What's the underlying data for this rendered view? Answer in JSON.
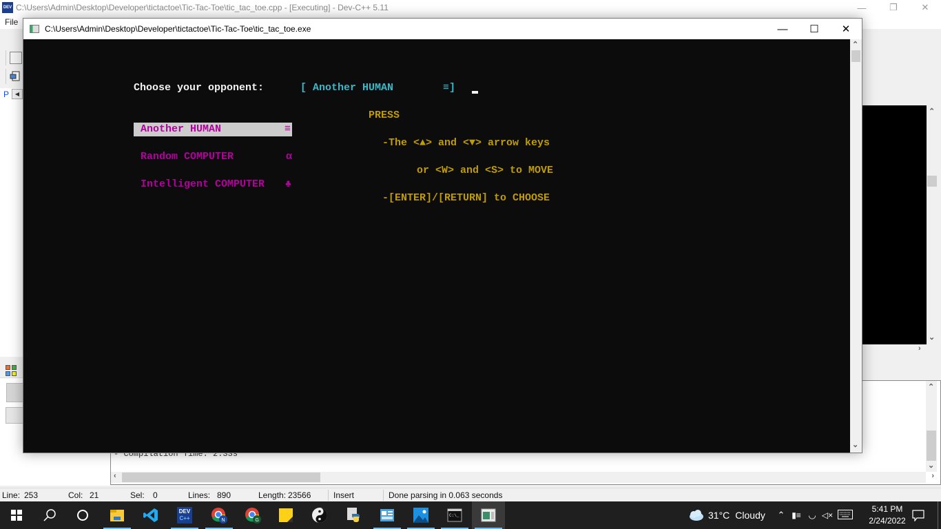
{
  "ide": {
    "title": "C:\\Users\\Admin\\Desktop\\Developer\\tictactoe\\Tic-Tac-Toe\\tic_tac_toe.cpp - [Executing] - Dev-C++ 5.11",
    "logo_text": "DEV",
    "menu_first": "File",
    "left_tab_label": "P",
    "compile_log_text": "- Compilation Time: 2.33s",
    "status": {
      "line_label": "Line:",
      "line_value": "253",
      "col_label": "Col:",
      "col_value": "21",
      "sel_label": "Sel:",
      "sel_value": "0",
      "lines_label": "Lines:",
      "lines_value": "890",
      "length_label": "Length:",
      "length_value": "23566",
      "mode": "Insert",
      "message": "Done parsing in 0.063 seconds"
    }
  },
  "console": {
    "title": "C:\\Users\\Admin\\Desktop\\Developer\\tictactoe\\Tic-Tac-Toe\\tic_tac_toe.exe",
    "prompt_label": "Choose your opponent:",
    "selected_display": "[ Another HUMAN        ≡]",
    "options": [
      {
        "label": "Another HUMAN",
        "symbol": "≡",
        "selected": true
      },
      {
        "label": "Random COMPUTER",
        "symbol": "α",
        "selected": false
      },
      {
        "label": "Intelligent COMPUTER",
        "symbol": "♣",
        "selected": false
      }
    ],
    "help": {
      "heading": "PRESS",
      "line1": "-The <▲> and <▼> arrow keys",
      "line2": "or <W> and <S> to MOVE",
      "line3": "-[ENTER]/[RETURN] to CHOOSE"
    },
    "colors": {
      "background": "#0c0c0c",
      "prompt": "#f2f2f2",
      "selection_display": "#3ab8c8",
      "options": "#b4009e",
      "highlight_bg": "#cccccc",
      "help": "#c19c00"
    }
  },
  "taskbar": {
    "apps": [
      {
        "name": "File Explorer",
        "icon": "folder-icon"
      },
      {
        "name": "Visual Studio Code",
        "icon": "vscode-icon"
      },
      {
        "name": "Dev-C++",
        "icon": "devcpp-icon"
      },
      {
        "name": "Chrome (N)",
        "icon": "chrome-icon"
      },
      {
        "name": "Chrome (G)",
        "icon": "chrome-icon"
      },
      {
        "name": "Sticky Notes",
        "icon": "sticky-notes-icon"
      },
      {
        "name": "Yin Yang App",
        "icon": "yin-yang-icon"
      },
      {
        "name": "Python",
        "icon": "python-icon"
      },
      {
        "name": "Control Panel",
        "icon": "control-panel-icon"
      },
      {
        "name": "Photos",
        "icon": "photos-icon"
      },
      {
        "name": "Command Prompt",
        "icon": "terminal-icon"
      },
      {
        "name": "Console Window",
        "icon": "console-window-icon"
      }
    ],
    "weather_temp": "31°C",
    "weather_desc": "Cloudy",
    "time": "5:41 PM",
    "date": "2/24/2022"
  }
}
